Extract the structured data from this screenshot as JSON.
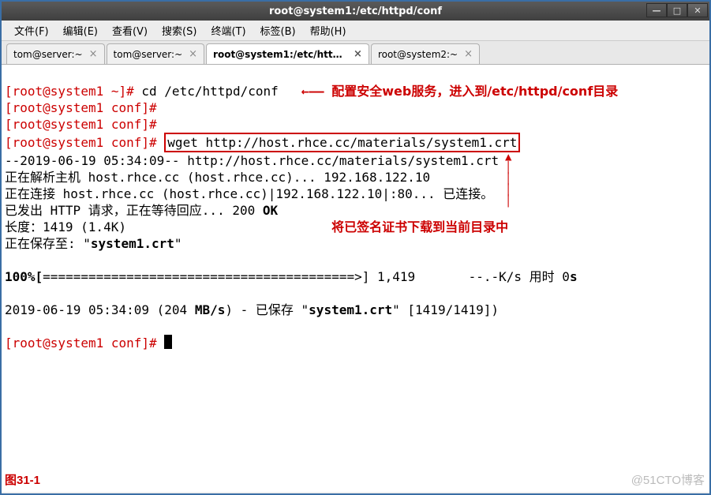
{
  "window": {
    "title": "root@system1:/etc/httpd/conf"
  },
  "menus": [
    {
      "label": "文件(F)"
    },
    {
      "label": "编辑(E)"
    },
    {
      "label": "查看(V)"
    },
    {
      "label": "搜索(S)"
    },
    {
      "label": "终端(T)"
    },
    {
      "label": "标签(B)"
    },
    {
      "label": "帮助(H)"
    }
  ],
  "tabs": [
    {
      "label": "tom@server:~",
      "active": false
    },
    {
      "label": "tom@server:~",
      "active": false
    },
    {
      "label": "root@system1:/etc/http…",
      "active": true
    },
    {
      "label": "root@system2:~",
      "active": false
    }
  ],
  "lines": {
    "p1_prompt": "[root@system1 ~]#",
    "p1_cmd": " cd /etc/httpd/conf",
    "p1_arrow": "←——",
    "p1_note": "配置安全web服务，进入到/etc/httpd/conf目录",
    "p2": "[root@system1 conf]#",
    "p3": "[root@system1 conf]#",
    "p4_prompt": "[root@system1 conf]#",
    "p4_cmd": "wget http://host.rhce.cc/materials/system1.crt",
    "l5": "--2019-06-19 05:34:09-- http://host.rhce.cc/materials/system1.crt",
    "l6": "正在解析主机 host.rhce.cc (host.rhce.cc)... 192.168.122.10",
    "l7": "正在连接 host.rhce.cc (host.rhce.cc)|192.168.122.10|:80... 已连接。",
    "l8a": "已发出 HTTP 请求，正在等待回应... 200 ",
    "l8b": "OK",
    "l9": "长度：1419 (1.4K)",
    "l10a": "正在保存至: \"",
    "l10b": "system1.crt",
    "l10c": "\"",
    "note2": "将已签名证书下载到当前目录中",
    "prog_a": "100%[",
    "prog_bar": "=========================================>",
    "prog_b": "] 1,419       --.-K/s 用时 0",
    "prog_c": "s",
    "l13a": "2019-06-19 05:34:09 (204 ",
    "l13b": "MB/s",
    "l13c": ") - 已保存 \"",
    "l13d": "system1.crt",
    "l13e": "\" [1419/1419])",
    "p_last": "[root@system1 conf]# "
  },
  "figure_label": "图31-1",
  "watermark": "@51CTO博客"
}
